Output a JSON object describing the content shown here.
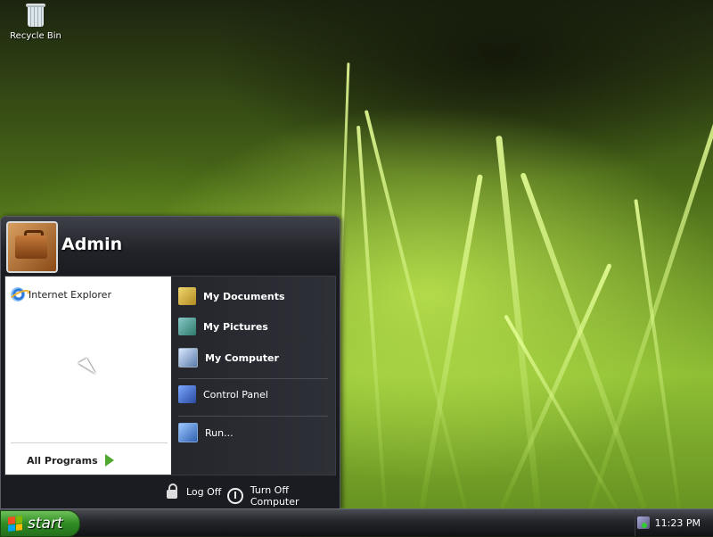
{
  "desktop": {
    "recycle_bin_label": "Recycle Bin"
  },
  "start_menu": {
    "user_name": "Admin",
    "pinned": [
      {
        "label": "Internet Explorer",
        "icon": "internet-explorer-icon"
      }
    ],
    "all_programs_label": "All Programs",
    "places": [
      {
        "label": "My Documents",
        "icon": "my-documents-icon",
        "bold": true
      },
      {
        "label": "My Pictures",
        "icon": "my-pictures-icon",
        "bold": true
      },
      {
        "label": "My Computer",
        "icon": "my-computer-icon",
        "bold": true
      },
      {
        "label": "Control Panel",
        "icon": "control-panel-icon",
        "bold": false
      },
      {
        "label": "Run...",
        "icon": "run-icon",
        "bold": false
      }
    ],
    "log_off_label": "Log Off",
    "turn_off_label": "Turn Off Computer"
  },
  "taskbar": {
    "start_label": "start",
    "clock": "11:23 PM"
  },
  "colors": {
    "start_green": "#2f8b23",
    "menu_dark": "#1b1c21",
    "left_pane": "#ffffff"
  }
}
